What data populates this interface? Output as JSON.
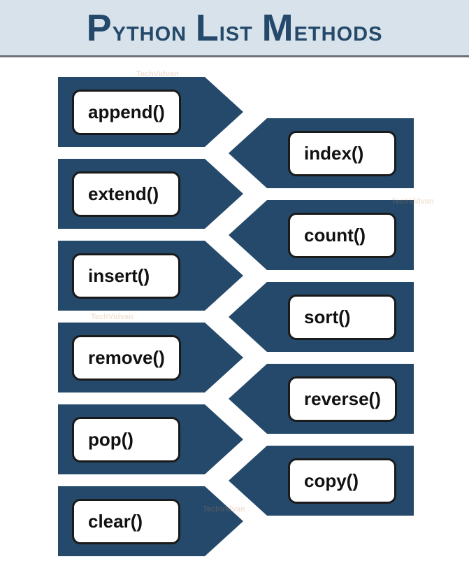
{
  "header": {
    "title_parts": [
      "P",
      "ython ",
      "L",
      "ist ",
      "M",
      "ethods"
    ]
  },
  "methods": {
    "left": [
      "append()",
      "extend()",
      "insert()",
      "remove()",
      "pop()",
      "clear()"
    ],
    "right": [
      "index()",
      "count()",
      "sort()",
      "reverse()",
      "copy()"
    ]
  },
  "watermark": "TechVidvan"
}
